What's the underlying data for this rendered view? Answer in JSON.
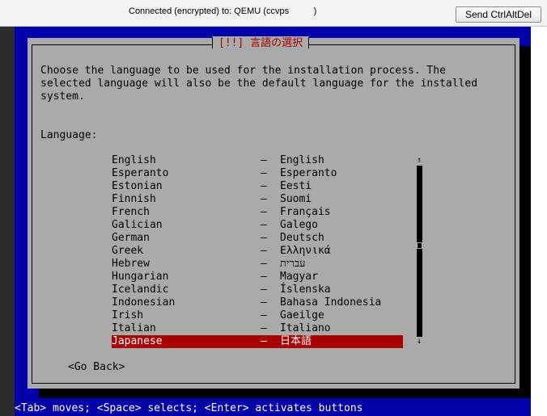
{
  "vnc": {
    "status": "Connected (encrypted) to: QEMU (ccvps          )",
    "send_button": "Send CtrlAltDel"
  },
  "dialog": {
    "title": "[!!] 言語の選択",
    "description": "Choose the language to be used for the installation process. The\nselected language will also be the default language for the installed\nsystem.",
    "language_label": "Language:",
    "languages": [
      {
        "name": "English",
        "native": "English",
        "selected": false
      },
      {
        "name": "Esperanto",
        "native": "Esperanto",
        "selected": false
      },
      {
        "name": "Estonian",
        "native": "Eesti",
        "selected": false
      },
      {
        "name": "Finnish",
        "native": "Suomi",
        "selected": false
      },
      {
        "name": "French",
        "native": "Français",
        "selected": false
      },
      {
        "name": "Galician",
        "native": "Galego",
        "selected": false
      },
      {
        "name": "German",
        "native": "Deutsch",
        "selected": false
      },
      {
        "name": "Greek",
        "native": "Ελληνικά",
        "selected": false
      },
      {
        "name": "Hebrew",
        "native": "עברית",
        "selected": false
      },
      {
        "name": "Hungarian",
        "native": "Magyar",
        "selected": false
      },
      {
        "name": "Icelandic",
        "native": "Íslenska",
        "selected": false
      },
      {
        "name": "Indonesian",
        "native": "Bahasa Indonesia",
        "selected": false
      },
      {
        "name": "Irish",
        "native": "Gaeilge",
        "selected": false
      },
      {
        "name": "Italian",
        "native": "Italiano",
        "selected": false
      },
      {
        "name": "Japanese",
        "native": "日本語",
        "selected": true
      }
    ],
    "separator": "–",
    "scroll_up_icon": "scroll-up-arrow-icon",
    "scroll_down_icon": "scroll-down-arrow-icon",
    "scroll_up_glyph": "↑",
    "scroll_down_glyph": "↓",
    "go_back": "<Go Back>"
  },
  "help_line": "<Tab> moves; <Space> selects; <Enter> activates buttons",
  "colors": {
    "screen_blue": "#0000a8",
    "dialog_gray": "#aaaaaa",
    "title_red": "#a80000",
    "selection_red": "#a80000"
  }
}
